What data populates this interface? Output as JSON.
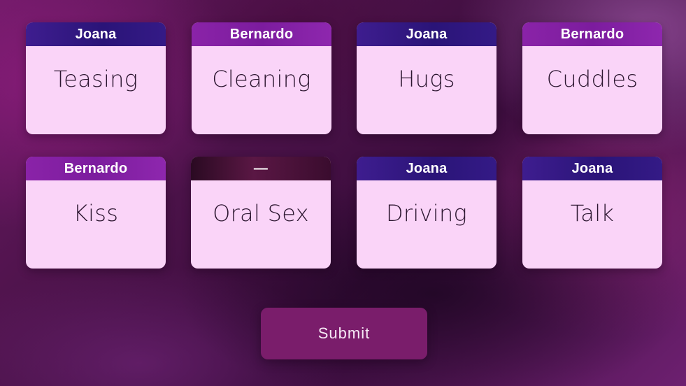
{
  "cards": [
    {
      "assignee": "Joana",
      "task": "Teasing",
      "header_color": "#2a1478"
    },
    {
      "assignee": "Bernardo",
      "task": "Cleaning",
      "header_color": "#7c1c9e"
    },
    {
      "assignee": "Joana",
      "task": "Hugs",
      "header_color": "#2a1478"
    },
    {
      "assignee": "Bernardo",
      "task": "Cuddles",
      "header_color": "#7c1c9e"
    },
    {
      "assignee": "Bernardo",
      "task": "Kiss",
      "header_color": "#7c1c9e"
    },
    {
      "assignee": "—",
      "task": "Oral Sex",
      "header_color": "#3a0c2e"
    },
    {
      "assignee": "Joana",
      "task": "Driving",
      "header_color": "#2a1478"
    },
    {
      "assignee": "Joana",
      "task": "Talk",
      "header_color": "#2a1478"
    }
  ],
  "actions": {
    "submit_label": "Submit"
  },
  "colors": {
    "card_body": "#fad4f8",
    "submit_button": "#7a1d6b"
  }
}
